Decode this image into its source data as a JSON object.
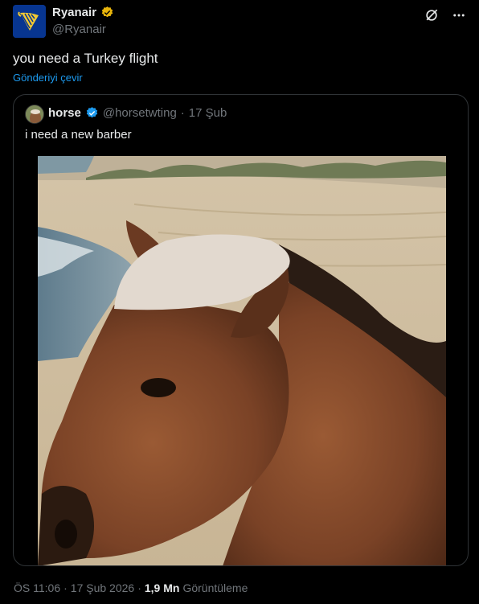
{
  "tweet": {
    "author_name": "Ryanair",
    "author_handle": "@Ryanair",
    "text": "you need a Turkey flight",
    "translate_label": "Gönderiyi çevir"
  },
  "quote": {
    "author_name": "horse",
    "author_handle": "@horsetwting",
    "separator": "·",
    "date": "17 Şub",
    "text": "i need a new barber"
  },
  "meta": {
    "time": "ÖS 11:06",
    "separator1": "·",
    "date": "17 Şub 2026",
    "separator2": "·",
    "views_count": "1,9 Mn",
    "views_label": "Görüntüleme"
  },
  "colors": {
    "background": "#000000",
    "accent": "#1d9bf0",
    "verified_gold": "#e8b50c",
    "brand_navy": "#073590"
  },
  "icons": [
    "ryanair-harp-logo",
    "verified-badge",
    "grok-icon",
    "more-icon",
    "horse-avatar"
  ]
}
